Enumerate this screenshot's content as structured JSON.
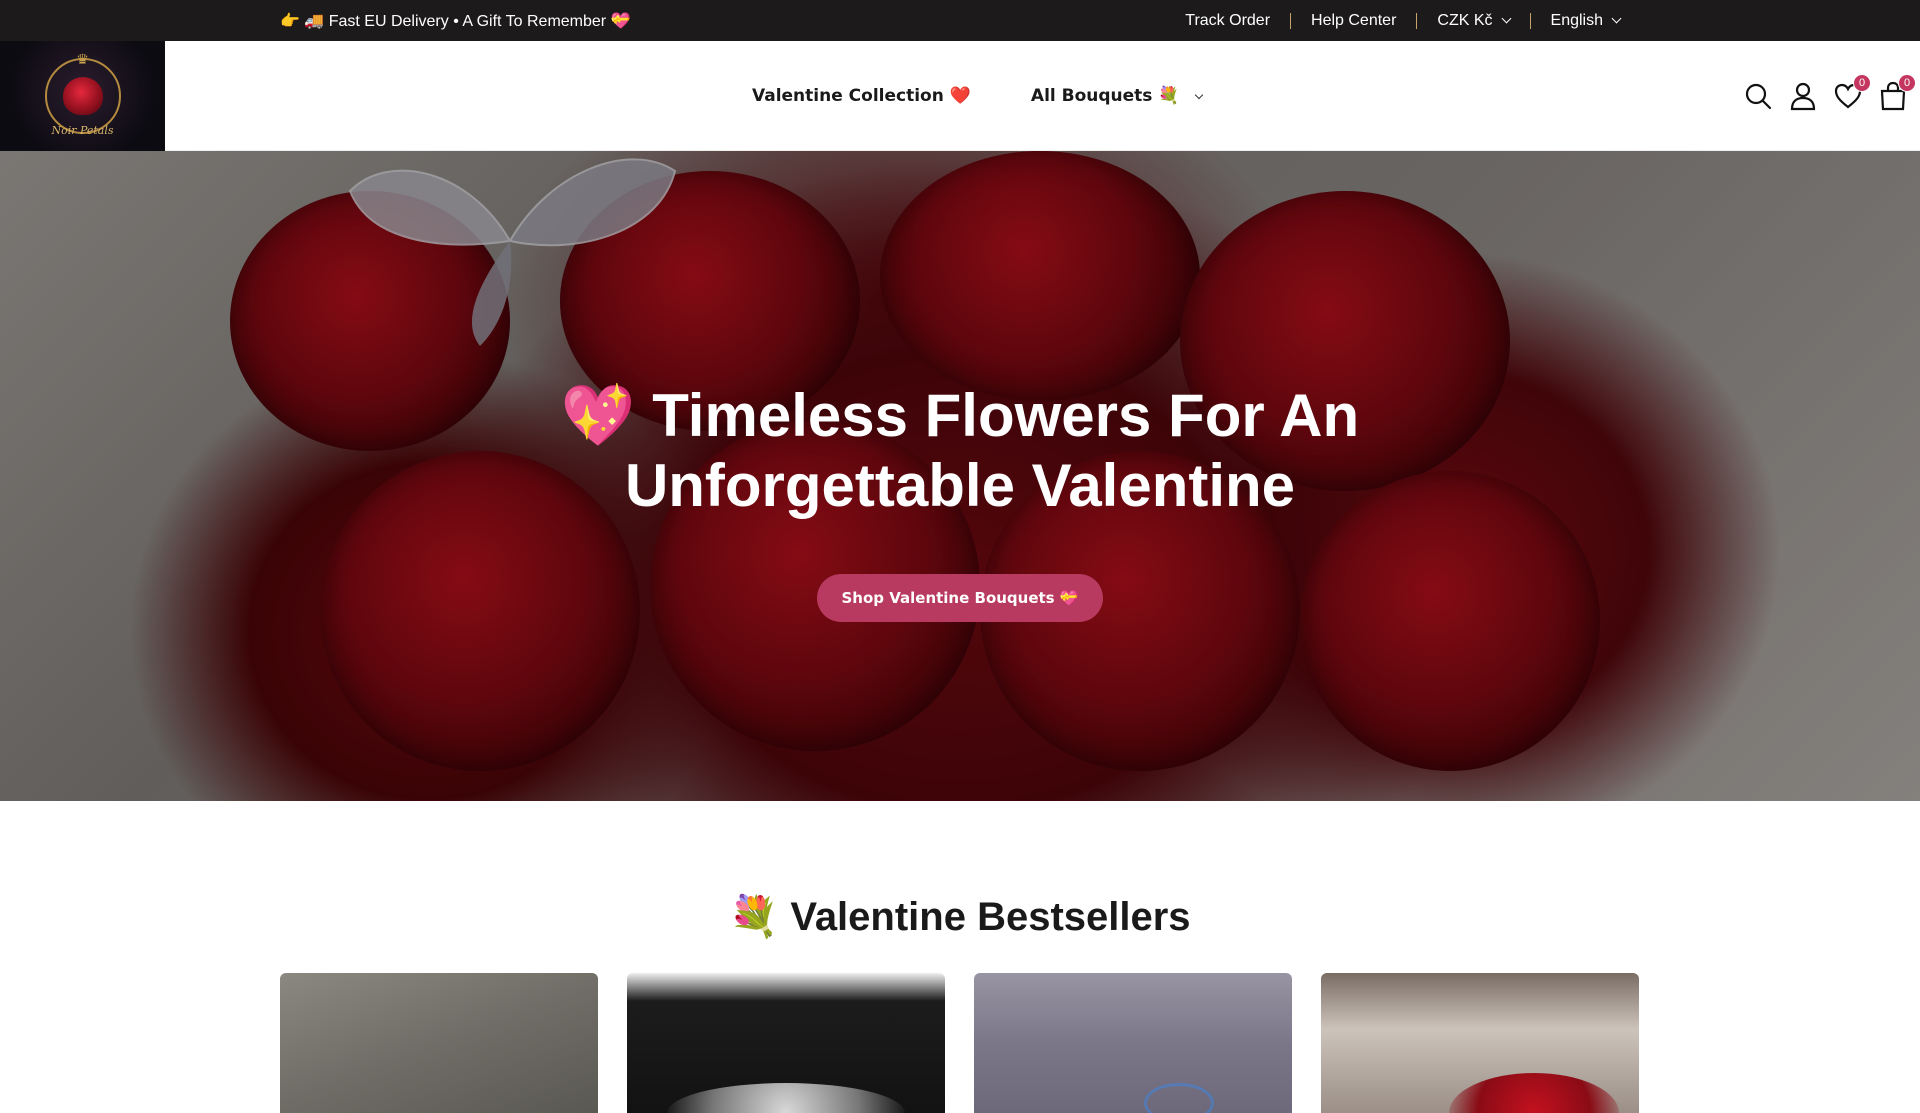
{
  "announcement": {
    "text": "👉 🚚 Fast EU Delivery • A Gift To Remember 💝"
  },
  "utility_links": {
    "track_order": "Track Order",
    "help_center": "Help Center",
    "currency": "CZK Kč",
    "language": "English"
  },
  "brand": {
    "logo_text": "Noir Petals"
  },
  "nav": {
    "items": [
      {
        "label": "Valentine Collection ❤️"
      },
      {
        "label": "All Bouquets 💐"
      }
    ]
  },
  "header_icons": {
    "search": "search-icon",
    "account": "user-icon",
    "wishlist": "heart-icon",
    "wishlist_count": "0",
    "cart": "bag-icon",
    "cart_count": "0"
  },
  "hero": {
    "title_line1": "💖 Timeless Flowers For An",
    "title_line2": "Unforgettable Valentine",
    "cta_label": "Shop Valentine Bouquets 💝"
  },
  "bestsellers": {
    "title": "💐 Valentine Bestsellers"
  },
  "colors": {
    "announcement_bg": "#1c1a1b",
    "accent": "#b83a60",
    "badge": "#c4365f",
    "separator": "#c9a16a"
  }
}
